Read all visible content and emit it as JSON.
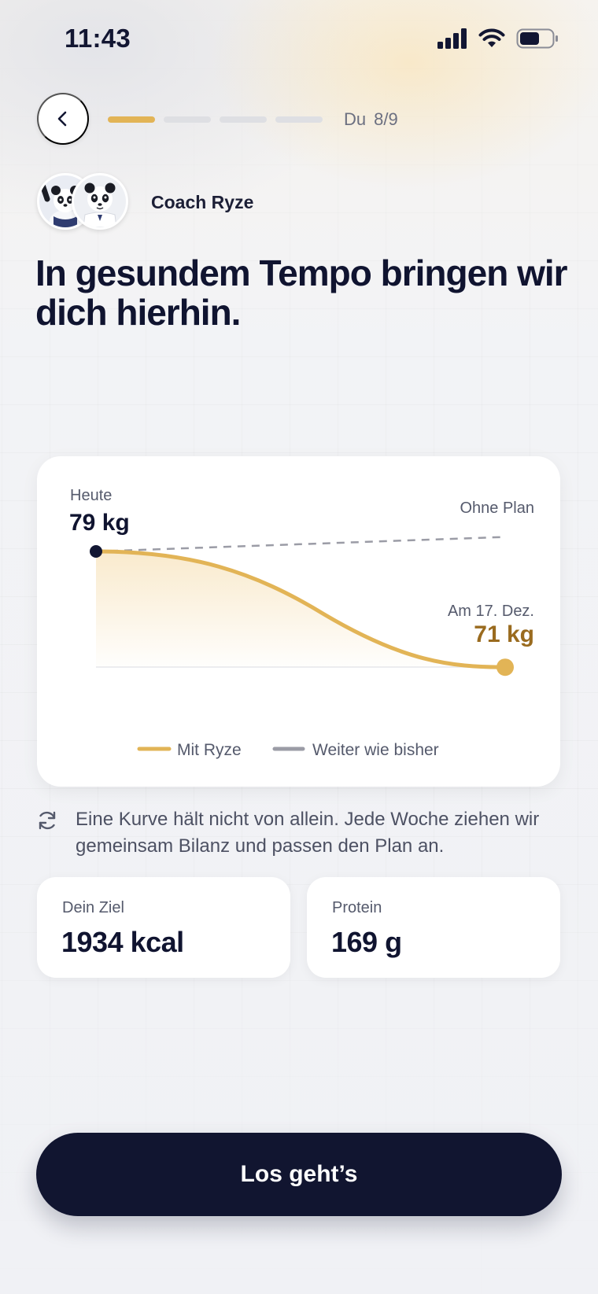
{
  "status_bar": {
    "time": "11:43"
  },
  "header": {
    "step_prefix": "Du",
    "step_counter": "8/9",
    "progress": {
      "current_step": 1,
      "total_segments": 4
    }
  },
  "coach": {
    "name": "Coach Ryze"
  },
  "headline": "In gesundem Tempo bringen wir dich hierhin.",
  "chart_data": {
    "type": "line",
    "start_label": "Heute",
    "start_value_text": "79 kg",
    "end_label": "Am 17. Dez.",
    "end_value_text": "71 kg",
    "baseline_label": "Ohne Plan",
    "series": [
      {
        "name": "Mit Ryze",
        "color": "#e2b456",
        "start": 79,
        "end": 71
      },
      {
        "name": "Weiter wie bisher",
        "color": "#9b9ca6",
        "start": 79,
        "end": 80
      }
    ]
  },
  "note": "Eine Kurve hält nicht von allein. Jede Woche ziehen wir gemeinsam Bilanz und passen den Plan an.",
  "stats": [
    {
      "label": "Dein Ziel",
      "value": "1934 kcal"
    },
    {
      "label": "Protein",
      "value": "169 g"
    }
  ],
  "cta": {
    "label": "Los geht’s"
  },
  "colors": {
    "accent": "#e2b456",
    "dark": "#111530",
    "end_value": "#9a6b1f"
  }
}
